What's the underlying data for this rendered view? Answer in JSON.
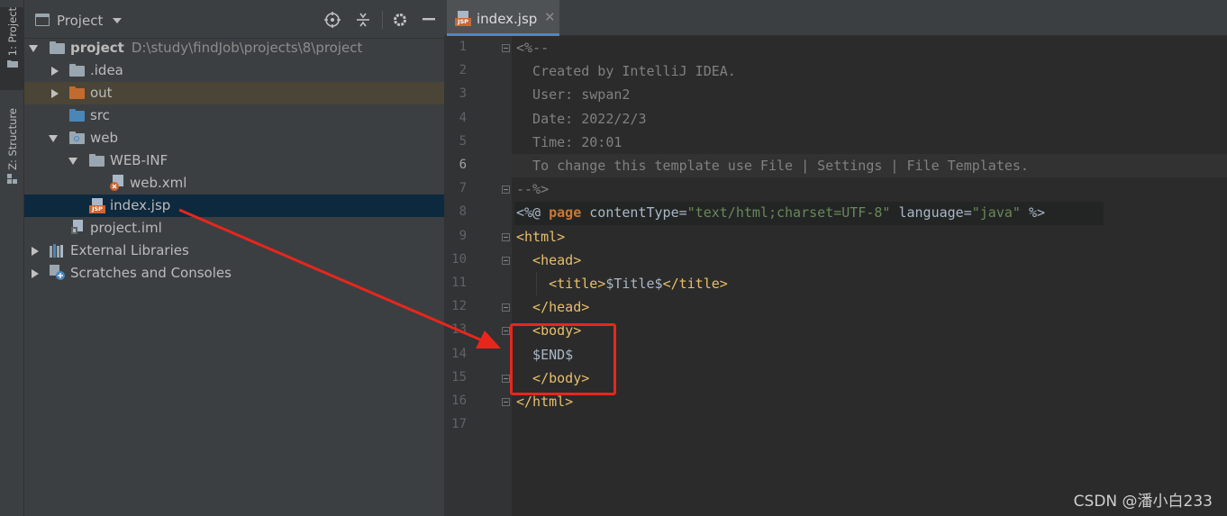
{
  "toolstrip": {
    "project_tab": "1: Project",
    "structure_tab": "Z: Structure"
  },
  "project_panel": {
    "title": "Project",
    "tree": [
      {
        "label": "project",
        "path": "D:\\study\\findJob\\projects\\8\\project",
        "bold": true,
        "depth": 0,
        "expanded": true,
        "icon": "module-folder-icon"
      },
      {
        "label": ".idea",
        "depth": 1,
        "expanded": false,
        "icon": "folder-icon"
      },
      {
        "label": "out",
        "depth": 1,
        "expanded": false,
        "icon": "excluded-folder-icon",
        "highlight": true
      },
      {
        "label": "src",
        "depth": 1,
        "icon": "source-folder-icon"
      },
      {
        "label": "web",
        "depth": 1,
        "expanded": true,
        "icon": "web-folder-icon"
      },
      {
        "label": "WEB-INF",
        "depth": 2,
        "expanded": true,
        "icon": "folder-icon"
      },
      {
        "label": "web.xml",
        "depth": 3,
        "icon": "xml-file-icon"
      },
      {
        "label": "index.jsp",
        "depth": 2,
        "icon": "jsp-file-icon",
        "selected": true
      },
      {
        "label": "project.iml",
        "depth": 1,
        "icon": "iml-file-icon"
      },
      {
        "label": "External Libraries",
        "depth": 0,
        "expanded": false,
        "icon": "libraries-icon"
      },
      {
        "label": "Scratches and Consoles",
        "depth": 0,
        "expanded": false,
        "icon": "scratches-icon"
      }
    ]
  },
  "editor": {
    "tab_label": "index.jsp",
    "current_line": 6,
    "lines": [
      {
        "n": "1",
        "segs": [
          {
            "t": "<%--",
            "c": "comment"
          }
        ]
      },
      {
        "n": "2",
        "segs": [
          {
            "t": "  Created by IntelliJ IDEA.",
            "c": "comment"
          }
        ]
      },
      {
        "n": "3",
        "segs": [
          {
            "t": "  User: swpan2",
            "c": "comment"
          }
        ]
      },
      {
        "n": "4",
        "segs": [
          {
            "t": "  Date: 2022/2/3",
            "c": "comment"
          }
        ]
      },
      {
        "n": "5",
        "segs": [
          {
            "t": "  Time: 20:01",
            "c": "comment"
          }
        ]
      },
      {
        "n": "6",
        "segs": [
          {
            "t": "  To change this template use File | Settings | File Templates.",
            "c": "comment"
          }
        ]
      },
      {
        "n": "7",
        "segs": [
          {
            "t": "--%>",
            "c": "comment"
          }
        ]
      },
      {
        "n": "8",
        "segs": [
          {
            "t": "<%@ ",
            "c": "plain"
          },
          {
            "t": "page",
            "c": "kw"
          },
          {
            "t": " contentType=",
            "c": "plain"
          },
          {
            "t": "\"text/html;charset=UTF-8\"",
            "c": "str"
          },
          {
            "t": " language=",
            "c": "plain"
          },
          {
            "t": "\"java\"",
            "c": "str"
          },
          {
            "t": " %>",
            "c": "plain"
          }
        ]
      },
      {
        "n": "9",
        "segs": [
          {
            "t": "<html>",
            "c": "tag"
          }
        ]
      },
      {
        "n": "10",
        "segs": [
          {
            "t": "  <head>",
            "c": "tag"
          }
        ]
      },
      {
        "n": "11",
        "segs": [
          {
            "t": "    <title>",
            "c": "tag"
          },
          {
            "t": "$Title$",
            "c": "plain"
          },
          {
            "t": "</title>",
            "c": "tag"
          }
        ]
      },
      {
        "n": "12",
        "segs": [
          {
            "t": "  </head>",
            "c": "tag"
          }
        ]
      },
      {
        "n": "13",
        "segs": [
          {
            "t": "  <body>",
            "c": "tag"
          }
        ]
      },
      {
        "n": "14",
        "segs": [
          {
            "t": "  $END$",
            "c": "plain"
          }
        ]
      },
      {
        "n": "15",
        "segs": [
          {
            "t": "  </body>",
            "c": "tag"
          }
        ]
      },
      {
        "n": "16",
        "segs": [
          {
            "t": "</html>",
            "c": "tag"
          }
        ]
      },
      {
        "n": "17",
        "segs": []
      }
    ]
  },
  "watermark": "CSDN @潘小白233",
  "colors": {
    "annotation_red": "#e8261c",
    "selection": "#0d293e",
    "tab_underline": "#4a88c7"
  }
}
